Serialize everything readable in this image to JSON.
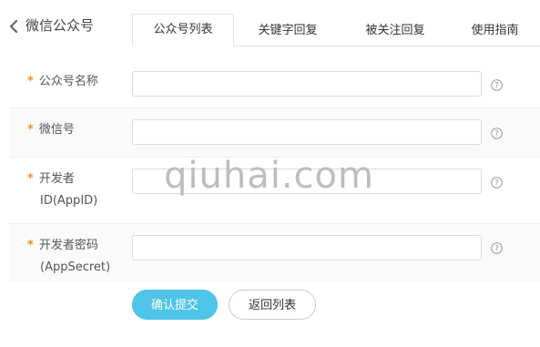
{
  "header": {
    "title": "微信公众号"
  },
  "tabs": [
    {
      "label": "公众号列表",
      "active": true
    },
    {
      "label": "关键字回复",
      "active": false
    },
    {
      "label": "被关注回复",
      "active": false
    },
    {
      "label": "使用指南",
      "active": false
    }
  ],
  "form": {
    "required_mark": "*",
    "fields": [
      {
        "label_line1": "公众号名称",
        "label_line2": "",
        "value": "",
        "icon": "help-icon"
      },
      {
        "label_line1": "微信号",
        "label_line2": "",
        "value": "",
        "icon": "help-icon"
      },
      {
        "label_line1": "开发者",
        "label_line2": "ID(AppID)",
        "value": "",
        "icon": "help-icon"
      },
      {
        "label_line1": "开发者密码",
        "label_line2": "(AppSecret)",
        "value": "",
        "icon": "help-icon"
      }
    ]
  },
  "buttons": {
    "submit": "确认提交",
    "back": "返回列表"
  },
  "watermark": "qiuhai.com",
  "colors": {
    "accent": "#4ec4e8",
    "required": "#f08c2e"
  }
}
